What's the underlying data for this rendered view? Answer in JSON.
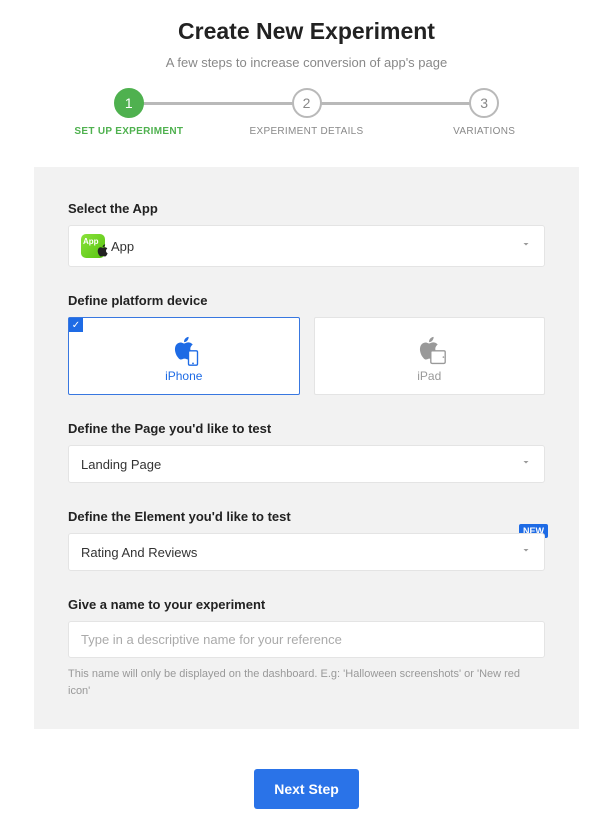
{
  "header": {
    "title": "Create New Experiment",
    "subtitle": "A few steps to increase conversion of app's page"
  },
  "stepper": {
    "steps": [
      {
        "num": "1",
        "label": "SET UP EXPERIMENT",
        "active": true
      },
      {
        "num": "2",
        "label": "EXPERIMENT DETAILS",
        "active": false
      },
      {
        "num": "3",
        "label": "VARIATIONS",
        "active": false
      }
    ]
  },
  "form": {
    "app": {
      "label": "Select the App",
      "selected": "App"
    },
    "platform": {
      "label": "Define platform device",
      "options": [
        "iPhone",
        "iPad"
      ],
      "selected": "iPhone"
    },
    "page": {
      "label": "Define the Page you'd like to test",
      "selected": "Landing Page"
    },
    "element": {
      "label": "Define the Element you'd like to test",
      "selected": "Rating And Reviews",
      "badge": "NEW"
    },
    "name": {
      "label": "Give a name to your experiment",
      "placeholder": "Type in a descriptive name for your reference",
      "value": "",
      "helper": "This name will only be displayed on the dashboard. E.g: 'Halloween screenshots' or 'New red icon'"
    }
  },
  "footer": {
    "next": "Next Step"
  }
}
